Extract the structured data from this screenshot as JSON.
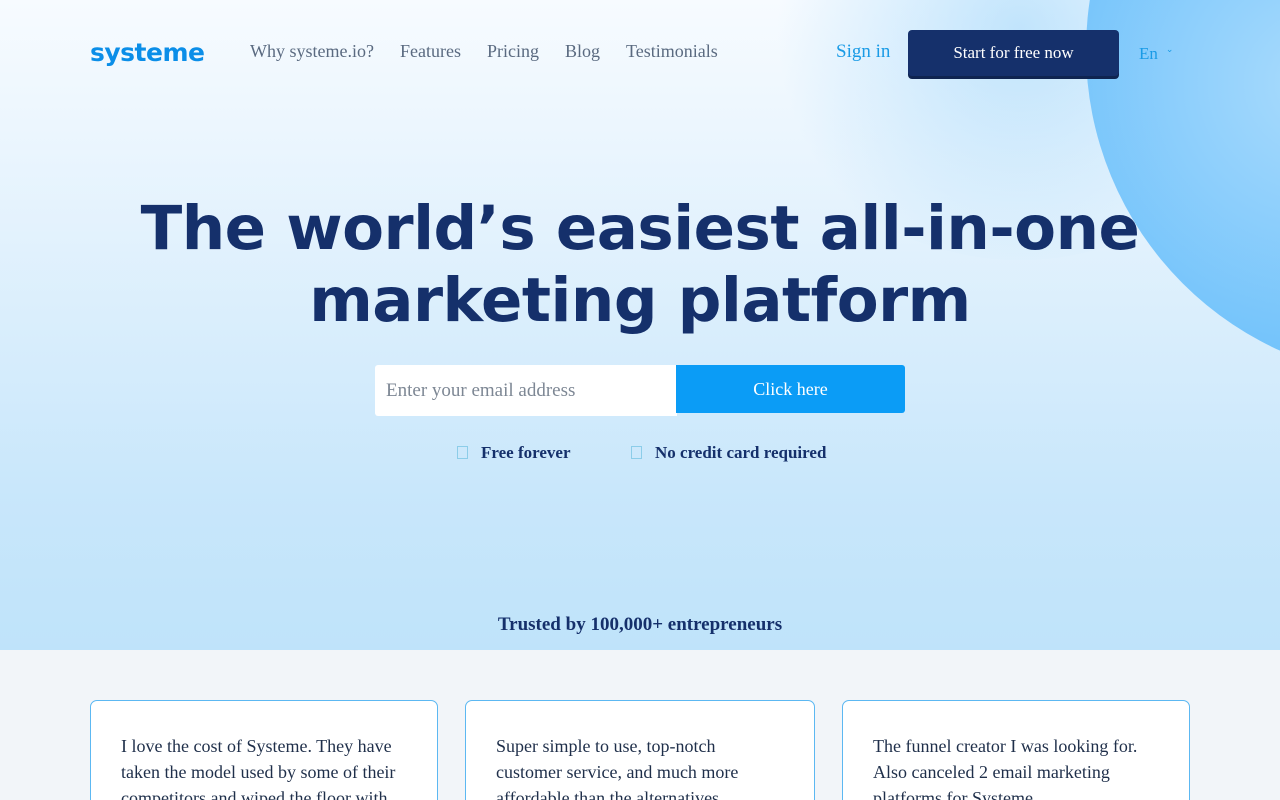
{
  "header": {
    "logo": "systeme",
    "nav": [
      {
        "label": "Why systeme.io?",
        "name": "nav-why-systeme"
      },
      {
        "label": "Features",
        "name": "nav-features"
      },
      {
        "label": "Pricing",
        "name": "nav-pricing"
      },
      {
        "label": "Blog",
        "name": "nav-blog"
      },
      {
        "label": "Testimonials",
        "name": "nav-testimonials"
      }
    ],
    "sign_in": "Sign in",
    "start_button": "Start for free now",
    "language": "En"
  },
  "hero": {
    "headline_line1": "The world’s easiest all-in-one",
    "headline_line2": "marketing platform",
    "email_placeholder": "Enter your email address",
    "cta_button": "Click here",
    "perk_1": "Free forever",
    "perk_2": "No credit card required",
    "trusted": "Trusted by 100,000+ entrepreneurs"
  },
  "testimonials": [
    {
      "text": "I love the cost of Systeme. They have taken the model used by some of their competitors and wiped the floor with"
    },
    {
      "text": "Super simple to use, top-notch customer service, and much more affordable than the alternatives"
    },
    {
      "text": "The funnel creator I was looking for. Also canceled 2 email marketing platforms for Systeme"
    }
  ],
  "colors": {
    "brand_dark": "#15306b",
    "brand_accent": "#0b9cf6",
    "link": "#1a9be6"
  }
}
